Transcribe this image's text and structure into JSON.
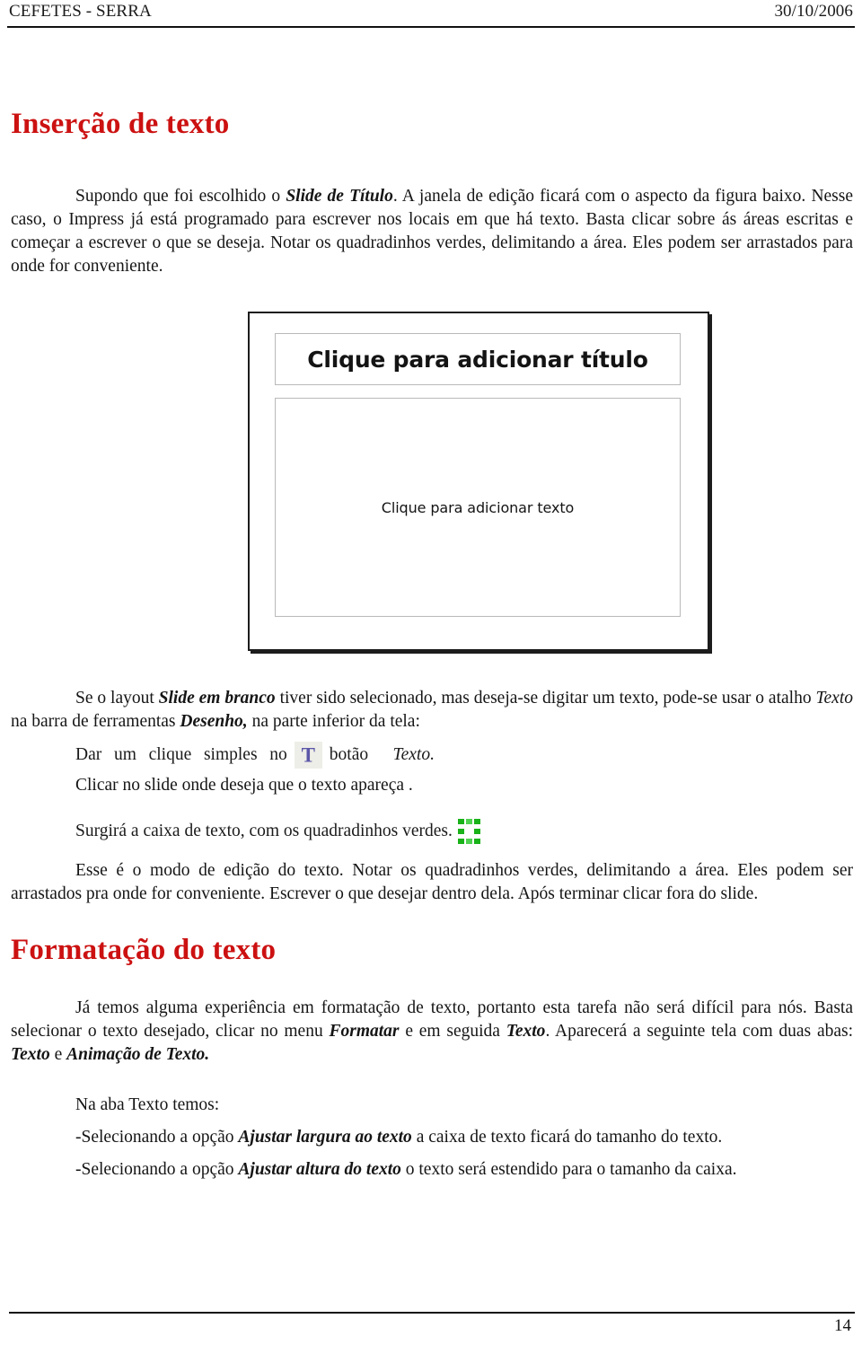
{
  "document": {
    "header": {
      "left": "CEFETES - SERRA",
      "right": "30/10/2006"
    },
    "footer": {
      "page_number": "14"
    },
    "headings": {
      "insercao": "Inserção de texto",
      "formatacao": "Formatação do texto",
      "color": "#cc1111"
    },
    "paragraphs": {
      "p1": {
        "part1": "Supondo que foi escolhido o ",
        "emph1": "Slide de Título",
        "part2": ". A janela de edição ficará com o aspecto da figura baixo. Nesse caso, o Impress já está programado para escrever nos locais em que há texto.       Basta clicar sobre ás áreas escritas e começar a escrever o que se deseja. Notar os quadradinhos verdes, delimitando a área. Eles podem ser arrastados para onde for conveniente."
      },
      "p2": {
        "part1": "Se o layout ",
        "emph1": "Slide em branco",
        "part2": " tiver sido selecionado, mas deseja-se digitar um texto, pode-se usar o atalho ",
        "emph2": "Texto",
        "part3": " na barra de ferramentas ",
        "emph3": "Desenho,",
        "part4": " na parte inferior da tela:"
      },
      "p3": {
        "w1": "Dar",
        "w2": "um",
        "w3": "clique",
        "w4": "simples",
        "w5": "no",
        "w6": "botão",
        "emph": "Texto."
      },
      "p4": "Clicar no slide onde deseja que o texto apareça .",
      "p5": "Surgirá a caixa de texto, com os quadradinhos verdes.",
      "p6": "Esse é o modo de edição do texto. Notar os quadradinhos verdes, delimitando a área. Eles podem ser arrastados pra onde for conveniente. Escrever o que desejar dentro dela. Após terminar clicar fora do slide.",
      "p7": {
        "part1": "Já temos alguma experiência em formatação de texto, portanto esta tarefa não será difícil para nós. Basta selecionar o texto desejado, clicar no menu ",
        "emph1": "Formatar",
        "part2": " e em seguida ",
        "emph2": "Texto",
        "part3": ". Aparecerá a seguinte tela com duas abas: ",
        "emph3": "Texto",
        "part4": " e ",
        "emph4": "Animação de Texto."
      },
      "p8": "Na aba Texto temos:",
      "p9": {
        "part1": "-Selecionando a opção ",
        "emph1": "Ajustar largura ao texto",
        "part2": " a caixa de texto ficará do tamanho do texto."
      },
      "p10": {
        "part1": "-Selecionando a opção ",
        "emph1": "Ajustar altura do texto",
        "part2": " o texto será estendido para o tamanho da caixa."
      }
    },
    "figure": {
      "name": "impress-slide-screenshot",
      "title_placeholder": "Clique para adicionar título",
      "body_placeholder": "Clique para adicionar texto"
    },
    "icons": {
      "text_tool": {
        "name": "text-tool-icon",
        "glyph": "T",
        "color": "#5b57a8",
        "background": "#eeeee8"
      },
      "selection_handles": {
        "name": "green-selection-handles-icon",
        "color": "#19b219"
      }
    }
  }
}
